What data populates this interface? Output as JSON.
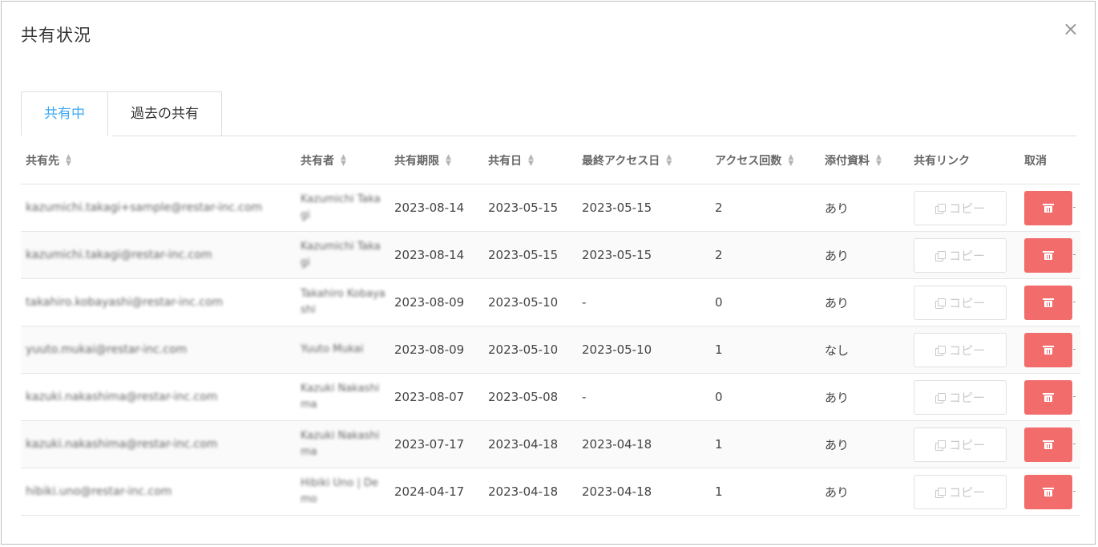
{
  "dialog": {
    "title": "共有状況",
    "close_label": "×"
  },
  "tabs": [
    {
      "label": "共有中",
      "active": true
    },
    {
      "label": "過去の共有",
      "active": false
    }
  ],
  "table": {
    "headers": {
      "email": "共有先",
      "sharer": "共有者",
      "expiry": "共有期限",
      "shared_date": "共有日",
      "last_access": "最終アクセス日",
      "access_count": "アクセス回数",
      "attachment": "添付資料",
      "link": "共有リンク",
      "cancel": "取消"
    },
    "copy_label": "コピー",
    "rows": [
      {
        "email": "kazumichi.takagi+sample@restar-inc.com",
        "sharer": "Kazumichi Takagi",
        "expiry": "2023-08-14",
        "shared_date": "2023-05-15",
        "last_access": "2023-05-15",
        "access_count": "2",
        "attachment": "あり"
      },
      {
        "email": "kazumichi.takagi@restar-inc.com",
        "sharer": "Kazumichi Takagi",
        "expiry": "2023-08-14",
        "shared_date": "2023-05-15",
        "last_access": "2023-05-15",
        "access_count": "2",
        "attachment": "あり"
      },
      {
        "email": "takahiro.kobayashi@restar-inc.com",
        "sharer": "Takahiro Kobayashi",
        "expiry": "2023-08-09",
        "shared_date": "2023-05-10",
        "last_access": "-",
        "access_count": "0",
        "attachment": "あり"
      },
      {
        "email": "yuuto.mukai@restar-inc.com",
        "sharer": "Yuuto Mukai",
        "expiry": "2023-08-09",
        "shared_date": "2023-05-10",
        "last_access": "2023-05-10",
        "access_count": "1",
        "attachment": "なし"
      },
      {
        "email": "kazuki.nakashima@restar-inc.com",
        "sharer": "Kazuki Nakashima",
        "expiry": "2023-08-07",
        "shared_date": "2023-05-08",
        "last_access": "-",
        "access_count": "0",
        "attachment": "あり"
      },
      {
        "email": "kazuki.nakashima@restar-inc.com",
        "sharer": "Kazuki Nakashima",
        "expiry": "2023-07-17",
        "shared_date": "2023-04-18",
        "last_access": "2023-04-18",
        "access_count": "1",
        "attachment": "あり"
      },
      {
        "email": "hibiki.uno@restar-inc.com",
        "sharer": "Hibiki Uno | Demo",
        "expiry": "2024-04-17",
        "shared_date": "2023-04-18",
        "last_access": "2023-04-18",
        "access_count": "1",
        "attachment": "あり"
      }
    ]
  },
  "colors": {
    "accent": "#3fa9f5",
    "danger": "#f26c6c"
  }
}
